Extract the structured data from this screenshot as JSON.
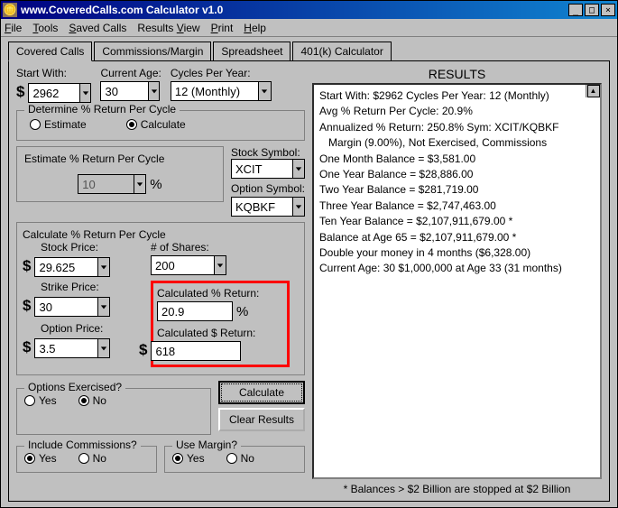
{
  "window": {
    "title": "www.CoveredCalls.com Calculator v1.0"
  },
  "menu": {
    "file": "File",
    "tools": "Tools",
    "saved": "Saved Calls",
    "results": "Results View",
    "print": "Print",
    "help": "Help"
  },
  "tabs": {
    "t1": "Covered Calls",
    "t2": "Commissions/Margin",
    "t3": "Spreadsheet",
    "t4": "401(k) Calculator"
  },
  "labels": {
    "start_with": "Start With:",
    "current_age": "Current Age:",
    "cycles": "Cycles Per Year:",
    "determine": "Determine % Return Per Cycle",
    "estimate": "Estimate",
    "calculate_radio": "Calculate",
    "estimate_group": "Estimate % Return Per Cycle",
    "stock_symbol": "Stock Symbol:",
    "option_symbol": "Option Symbol:",
    "calc_group": "Calculate % Return Per Cycle",
    "stock_price": "Stock Price:",
    "num_shares": "# of Shares:",
    "strike_price": "Strike Price:",
    "calc_pct_return": "Calculated % Return:",
    "option_price": "Option Price:",
    "calc_dollar_return": "Calculated $ Return:",
    "options_exercised": "Options Exercised?",
    "yes": "Yes",
    "no": "No",
    "include_comm": "Include Commissions?",
    "use_margin": "Use Margin?",
    "calculate_btn": "Calculate",
    "clear_btn": "Clear Results",
    "results_title": "RESULTS",
    "footer": "* Balances > $2 Billion are stopped at $2 Billion"
  },
  "values": {
    "start_with": "2962",
    "current_age": "30",
    "cycles": "12 (Monthly)",
    "estimate_pct": "10",
    "stock_symbol": "XCIT",
    "option_symbol": "KQBKF",
    "stock_price": "29.625",
    "num_shares": "200",
    "strike_price": "30",
    "calc_pct_return": "20.9",
    "option_price": "3.5",
    "calc_dollar_return": "618"
  },
  "results": {
    "l1": "Start With: $2962     Cycles Per Year: 12 (Monthly)",
    "l2": "Avg % Return Per Cycle: 20.9%",
    "l3": "Annualized % Return: 250.8%    Sym: XCIT/KQBKF",
    "l4": "   Margin (9.00%),  Not Exercised,  Commissions",
    "l5": "One Month Balance = $3,581.00",
    "l6": "One Year Balance = $28,886.00",
    "l7": "Two Year Balance = $281,719.00",
    "l8": "Three Year Balance = $2,747,463.00",
    "l9": "Ten Year Balance = $2,107,911,679.00 *",
    "l10": "Balance at Age 65 = $2,107,911,679.00 *",
    "l11": "Double your money in 4 months ($6,328.00)",
    "l12": "Current Age: 30     $1,000,000 at Age 33 (31 months)"
  }
}
